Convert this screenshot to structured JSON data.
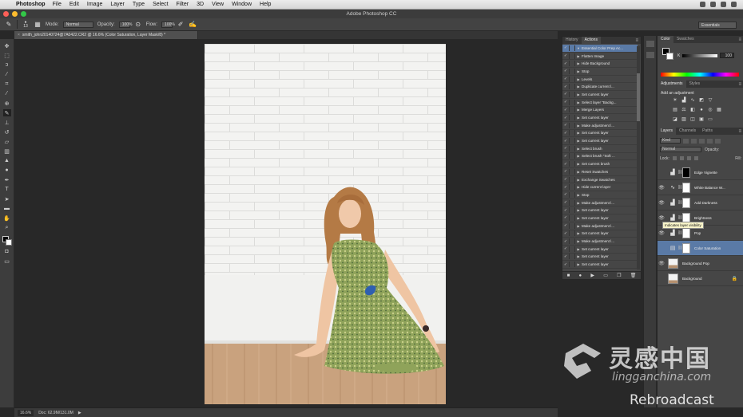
{
  "menubar": {
    "app_name": "Photoshop",
    "items": [
      "File",
      "Edit",
      "Image",
      "Layer",
      "Type",
      "Select",
      "Filter",
      "3D",
      "View",
      "Window",
      "Help"
    ]
  },
  "window": {
    "title": "Adobe Photoshop CC"
  },
  "options_bar": {
    "brush_size": "13",
    "mode_label": "Mode:",
    "mode_value": "Normal",
    "opacity_label": "Opacity:",
    "opacity_value": "100%",
    "flow_label": "Flow:",
    "flow_value": "100%",
    "workspace": "Essentials"
  },
  "document": {
    "tab_title": "smith_john20140724@7A0422.CR2 @ 16.6% (Color Saturation, Layer Mask/8) *"
  },
  "statusbar": {
    "zoom": "16.6%",
    "doc_info": "Doc: 62.9M/131.0M"
  },
  "actions_panel": {
    "tabs": [
      "History",
      "Actions"
    ],
    "rows": [
      {
        "label": "Essential Color Prep Ac...",
        "selected": true
      },
      {
        "label": "Flatten Image",
        "selected": false
      },
      {
        "label": "Hide Background",
        "selected": false
      },
      {
        "label": "Stop",
        "selected": false
      },
      {
        "label": "Levels",
        "selected": false
      },
      {
        "label": "Duplicate current l...",
        "selected": false
      },
      {
        "label": "Set current layer",
        "selected": false
      },
      {
        "label": "Select layer \"Backg...",
        "selected": false
      },
      {
        "label": "Merge Layers",
        "selected": false
      },
      {
        "label": "Set current layer",
        "selected": false
      },
      {
        "label": "Make adjustment l...",
        "selected": false
      },
      {
        "label": "Set current layer",
        "selected": false
      },
      {
        "label": "Set current layer",
        "selected": false
      },
      {
        "label": "Select brush",
        "selected": false
      },
      {
        "label": "Select brush \"Soft ...",
        "selected": false
      },
      {
        "label": "Set current brush",
        "selected": false
      },
      {
        "label": "Reset Swatches",
        "selected": false
      },
      {
        "label": "Exchange Swatches",
        "selected": false
      },
      {
        "label": "Hide current layer",
        "selected": false
      },
      {
        "label": "Stop",
        "selected": false
      },
      {
        "label": "Make adjustment l...",
        "selected": false
      },
      {
        "label": "Set current layer",
        "selected": false
      },
      {
        "label": "Set current layer",
        "selected": false
      },
      {
        "label": "Make adjustment l...",
        "selected": false
      },
      {
        "label": "Set current layer",
        "selected": false
      },
      {
        "label": "Make adjustment l...",
        "selected": false
      },
      {
        "label": "Set current layer",
        "selected": false
      },
      {
        "label": "Set current layer",
        "selected": false
      },
      {
        "label": "Set current layer",
        "selected": false
      }
    ]
  },
  "color_panel": {
    "tabs": [
      "Color",
      "Swatches"
    ],
    "channel_label": "K",
    "value": "100"
  },
  "adjustments_panel": {
    "tabs": [
      "Adjustments",
      "Styles"
    ],
    "title": "Add an adjustment"
  },
  "layers_panel": {
    "tabs": [
      "Layers",
      "Channels",
      "Paths"
    ],
    "filter_kind": "Kind",
    "blend_mode": "Normal",
    "opacity_label": "Opacity:",
    "lock_label": "Lock:",
    "fill_label": "Fill:",
    "layers": [
      {
        "name": "Edge Vignette",
        "type": "adjustment",
        "icon": "levels-icon",
        "visible": false,
        "selected": false,
        "mask": "#000000"
      },
      {
        "name": "White Balance W...",
        "type": "adjustment",
        "icon": "curves-icon",
        "visible": true,
        "selected": false,
        "mask": "#ffffff"
      },
      {
        "name": "Add Darkness",
        "type": "adjustment",
        "icon": "levels-icon",
        "visible": true,
        "selected": false,
        "mask": "#ffffff"
      },
      {
        "name": "Brightness",
        "type": "adjustment",
        "icon": "levels-icon",
        "visible": true,
        "selected": false,
        "mask": "#ffffff"
      },
      {
        "name": "Pop",
        "type": "adjustment",
        "icon": "levels-icon",
        "visible": true,
        "selected": false,
        "mask": "#ffffff"
      },
      {
        "name": "Color Saturation",
        "type": "adjustment",
        "icon": "hue-saturation-icon",
        "visible": false,
        "selected": true,
        "mask": "#ffffff"
      },
      {
        "name": "Background Pop",
        "type": "pixel",
        "visible": true,
        "selected": false
      },
      {
        "name": "Background",
        "type": "pixel",
        "visible": false,
        "selected": false,
        "locked": true
      }
    ],
    "tooltip": "Indicates layer visibility"
  },
  "watermark": {
    "logo_text": "灵感中国",
    "url": "lingganchina.com",
    "rebroadcast": "Rebroadcast"
  },
  "colors": {
    "selection_blue": "#5a7aa6",
    "panel_gray": "#464646",
    "canvas_gray": "#282828"
  }
}
